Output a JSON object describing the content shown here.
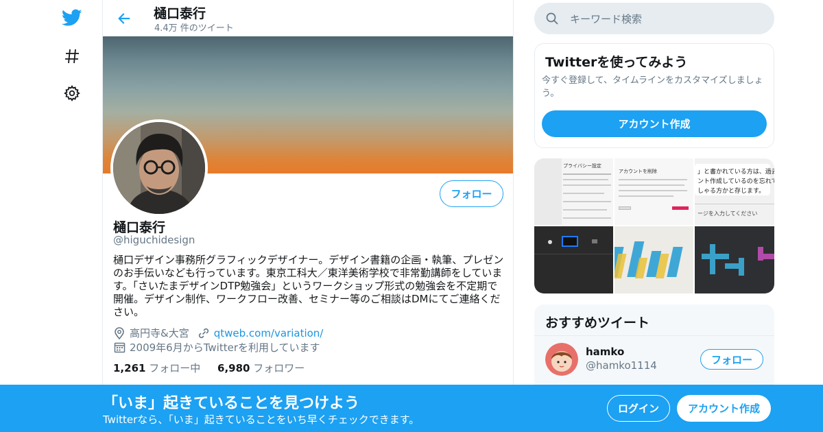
{
  "colors": {
    "accent": "#1da1f2",
    "secondary_text": "#657786",
    "text": "#14171a",
    "link": "#1b95e0"
  },
  "nav": {
    "icons": [
      "twitter-logo-icon",
      "hashtag-icon",
      "gear-icon"
    ]
  },
  "header": {
    "name": "樋口泰行",
    "tweet_count": "4.4万 件のツイート"
  },
  "profile": {
    "follow_label": "フォロー",
    "name": "樋口泰行",
    "handle": "@higuchidesign",
    "bio": "樋口デザイン事務所グラフィックデザイナー。デザイン書籍の企画・執筆、プレゼンのお手伝いなども行っています。東京工科大／東洋美術学校で非常勤講師をしています。「さいたまデザインDTP勉強会」というワークショップ形式の勉強会を不定期で開催。デザイン制作、ワークフロー改善、セミナー等のご相談はDMにてご連絡ください。",
    "location": "高円寺&大宮",
    "url": "qtweb.com/variation/",
    "joined": "2009年6月からTwitterを利用しています",
    "following_count": "1,261",
    "following_label": "フォロー中",
    "followers_count": "6,980",
    "followers_label": "フォロワー"
  },
  "search": {
    "placeholder": "キーワード検索"
  },
  "signup_card": {
    "title": "Twitterを使ってみよう",
    "description": "今すぐ登録して、タイムラインをカスタマイズしましょう。",
    "button": "アカウント作成"
  },
  "media": {
    "tile_texts": {
      "t1_heading": "プライバシー設定",
      "t2_heading": "アカウントを削除",
      "t3_line1": "」と書かれている方は、過去に",
      "t3_line2": "ント作成しているのを忘れて",
      "t3_line3": "しゃる方かと存じます。",
      "t3_line4": "ージを入力してください"
    }
  },
  "recommended": {
    "title": "おすすめツイート",
    "user_name": "hamko",
    "user_handle": "@hamko1114",
    "follow_label": "フォロー"
  },
  "bottombar": {
    "title": "「いま」起きていることを見つけよう",
    "subtitle": "Twitterなら、「いま」起きていることをいち早くチェックできます。",
    "login": "ログイン",
    "signup": "アカウント作成"
  }
}
